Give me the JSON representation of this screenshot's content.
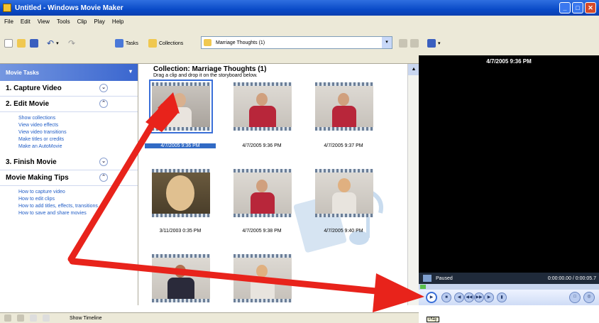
{
  "window": {
    "title": "Untitled - Windows Movie Maker"
  },
  "menu": [
    "File",
    "Edit",
    "View",
    "Tools",
    "Clip",
    "Play",
    "Help"
  ],
  "toolbar": {
    "tasks_label": "Tasks",
    "collections_label": "Collections",
    "collection_select_value": "Marriage Thoughts (1)"
  },
  "task_pane": {
    "header": "Movie Tasks",
    "sections": [
      {
        "label": "1. Capture Video",
        "toggle": "⌄",
        "links": []
      },
      {
        "label": "2. Edit Movie",
        "toggle": "⌃",
        "links": [
          "Show collections",
          "View video effects",
          "View video transitions",
          "Make titles or credits",
          "Make an AutoMovie"
        ]
      },
      {
        "label": "3. Finish Movie",
        "toggle": "⌄",
        "links": []
      },
      {
        "label": "Movie Making Tips",
        "toggle": "⌃",
        "links": [
          "How to capture video",
          "How to edit clips",
          "How to add titles, effects, transitions",
          "How to save and share movies"
        ]
      }
    ]
  },
  "collection": {
    "title": "Collection: Marriage Thoughts (1)",
    "subtitle": "Drag a clip and drop it on the storyboard below.",
    "clips": [
      {
        "caption": "4/7/2005 9:36 PM",
        "selected": true
      },
      {
        "caption": "4/7/2005 9:36 PM",
        "selected": false
      },
      {
        "caption": "4/7/2005 9:37 PM",
        "selected": false
      },
      {
        "caption": "3/11/2003 0:35 PM",
        "selected": false
      },
      {
        "caption": "4/7/2005 9:38 PM",
        "selected": false
      },
      {
        "caption": "4/7/2005 9:40 PM",
        "selected": false
      },
      {
        "caption": "",
        "selected": false
      },
      {
        "caption": "",
        "selected": false
      }
    ]
  },
  "preview": {
    "date": "4/7/2005 9:36 PM",
    "status": "Paused",
    "time": "0:00:00.00 / 0:00:05.7"
  },
  "tooltip": "Play",
  "bottom": {
    "show_timeline": "Show Timeline"
  },
  "colors": {
    "arrow": "#e8231b",
    "title_bar": "#0a4bc8",
    "link": "#215dc6"
  }
}
